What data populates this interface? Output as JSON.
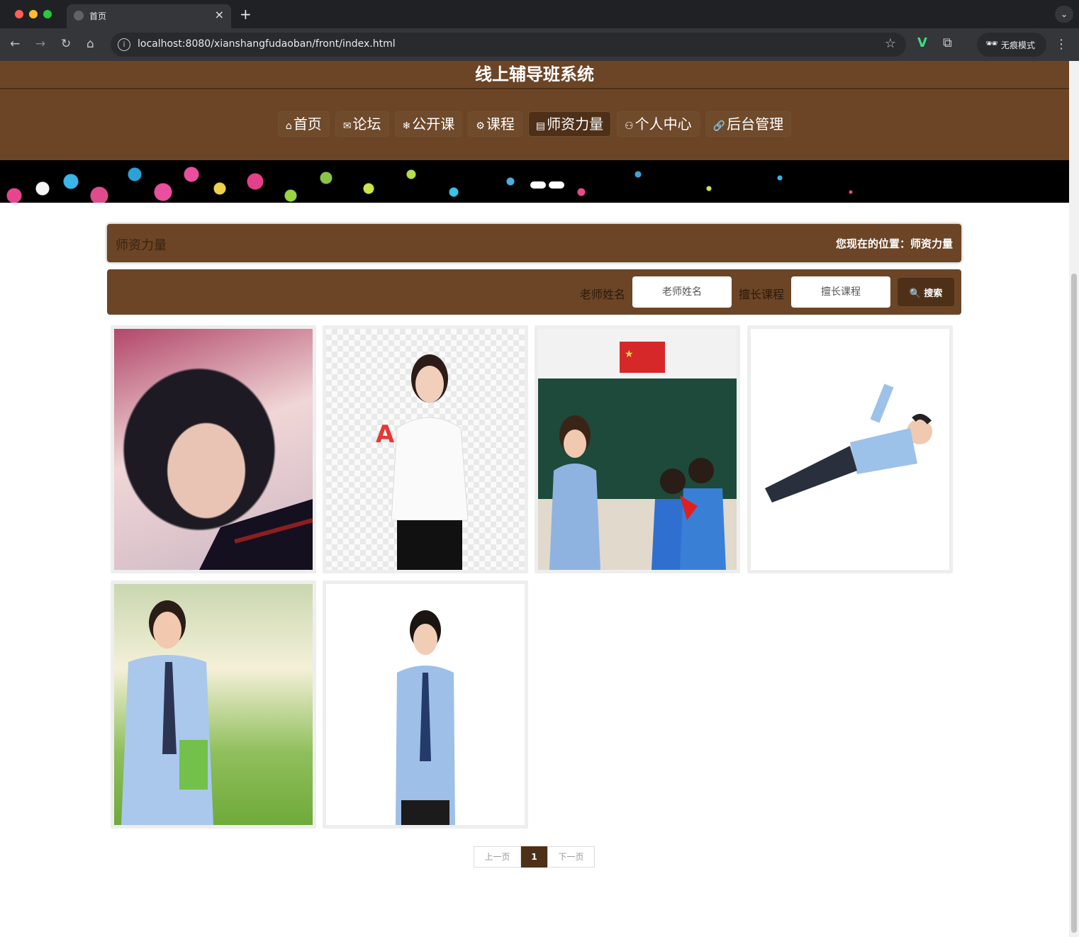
{
  "browser": {
    "tab_title": "首页",
    "url": "localhost:8080/xianshangfudaoban/front/index.html",
    "incognito_label": "无痕模式"
  },
  "site": {
    "title": "线上辅导班系统"
  },
  "nav": [
    {
      "label": "首页",
      "icon": "home-icon",
      "glyph": "⌂"
    },
    {
      "label": "论坛",
      "icon": "mail-icon",
      "glyph": "✉"
    },
    {
      "label": "公开课",
      "icon": "snowflake-icon",
      "glyph": "❄"
    },
    {
      "label": "课程",
      "icon": "gear-icon",
      "glyph": "⚙"
    },
    {
      "label": "师资力量",
      "icon": "calendar-icon",
      "glyph": "▤"
    },
    {
      "label": "个人中心",
      "icon": "user-icon",
      "glyph": "⚇"
    },
    {
      "label": "后台管理",
      "icon": "link-icon",
      "glyph": "🔗"
    }
  ],
  "breadcrumb": {
    "section_title": "师资力量",
    "location": "您现在的位置：师资力量"
  },
  "search": {
    "teacher_label": "老师姓名",
    "teacher_placeholder": "老师姓名",
    "course_label": "擅长课程",
    "course_placeholder": "擅长课程",
    "button_label": "搜索"
  },
  "pagination": {
    "prev": "上一页",
    "current": "1",
    "next": "下一页"
  },
  "colors": {
    "primary": "#6b4526",
    "primary_dark": "#4e3018"
  }
}
